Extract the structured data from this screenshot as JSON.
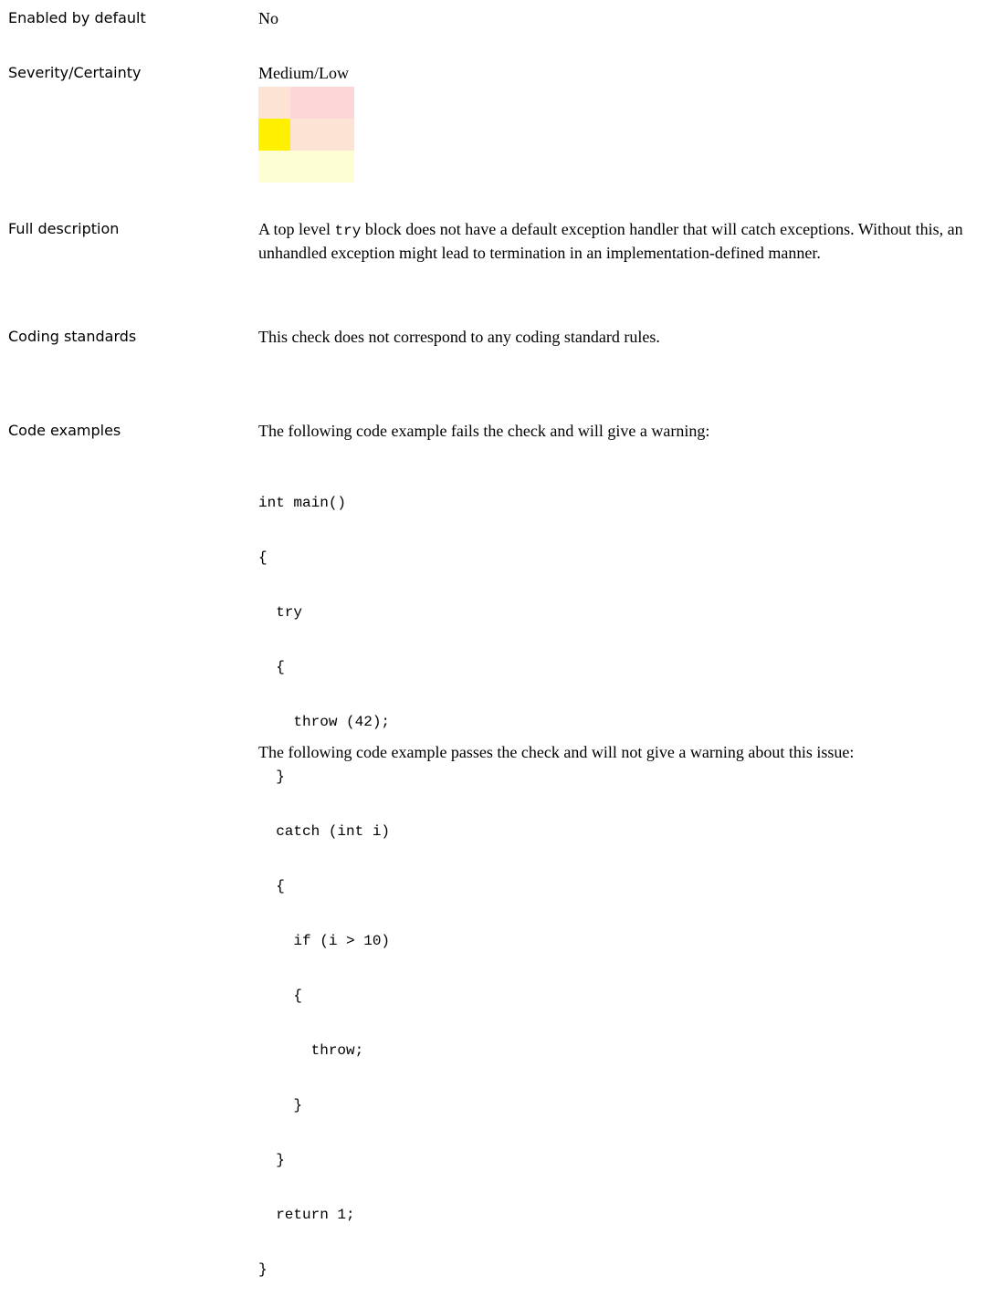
{
  "rows": {
    "enabled": {
      "label": "Enabled by default",
      "value": "No"
    },
    "severity": {
      "label": "Severity/Certainty",
      "value": "Medium/Low"
    },
    "description": {
      "label": "Full description",
      "text_before": "A top level ",
      "code_word": "try",
      "text_after": " block does not have a default exception handler that will catch exceptions. Without this, an unhandled exception might lead to termination in an implementation-defined manner."
    },
    "coding_standards": {
      "label": "Coding standards",
      "value": "This check does not correspond to any coding standard rules."
    },
    "code_examples": {
      "label": "Code examples",
      "intro_fail": "The following code example fails the check and will give a warning:",
      "fail_code": [
        "int main()",
        "{",
        "  try",
        "  {",
        "    throw (42);",
        "  }",
        "  catch (int i)",
        "  {",
        "    if (i > 10)",
        "    {",
        "      throw;",
        "    }",
        "  }",
        "  return 1;",
        "}"
      ],
      "intro_pass": "The following code example passes the check and will not give a warning about this issue:"
    }
  },
  "severity_matrix": {
    "colors": [
      [
        "#fde3d4",
        "#fdd6d8",
        "#fdd6d8"
      ],
      [
        "#fff000",
        "#fde3d4",
        "#fde3d4"
      ],
      [
        "#fefed4",
        "#fefed4",
        "#fefed4"
      ]
    ]
  }
}
